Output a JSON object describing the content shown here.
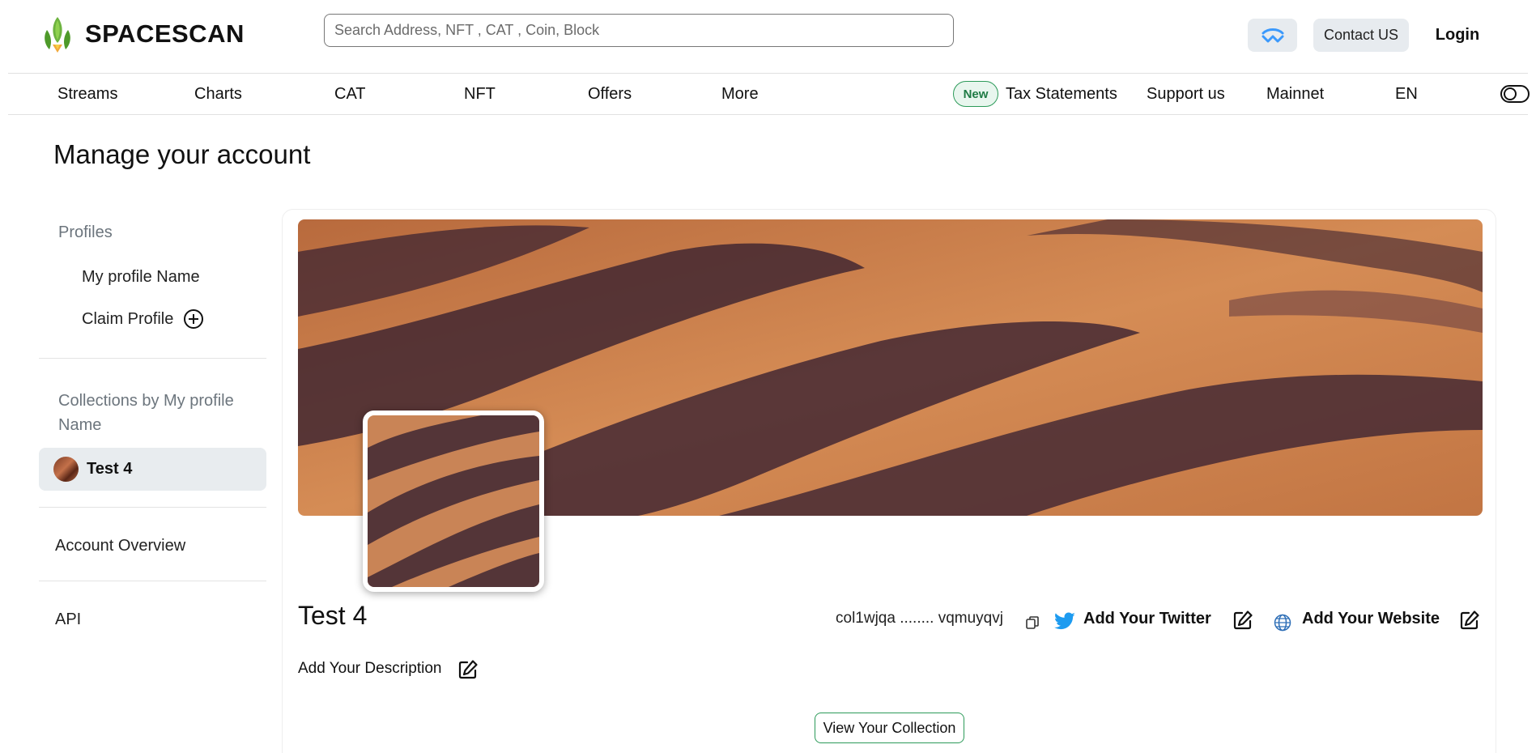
{
  "brand": {
    "name": "SPACESCAN"
  },
  "header": {
    "search_placeholder": "Search Address, NFT , CAT , Coin, Block",
    "contact_label": "Contact US",
    "login_label": "Login"
  },
  "nav": {
    "items": [
      "Streams",
      "Charts",
      "CAT",
      "NFT",
      "Offers",
      "More"
    ],
    "new_badge": "New",
    "tax_label": "Tax Statements",
    "support_label": "Support us",
    "network_label": "Mainnet",
    "language_label": "EN"
  },
  "page": {
    "title": "Manage your account"
  },
  "sidebar": {
    "profiles_heading": "Profiles",
    "profile_name": "My profile Name",
    "claim_label": "Claim Profile",
    "collections_heading": "Collections by My profile Name",
    "active_collection": "Test 4",
    "account_overview": "Account Overview",
    "api": "API"
  },
  "collection": {
    "name": "Test 4",
    "address": "col1wjqa ........ vqmuyqvj",
    "twitter_label": "Add Your Twitter",
    "website_label": "Add Your Website",
    "description_label": "Add Your Description",
    "view_button": "View Your Collection"
  },
  "colors": {
    "accent_green": "#2c9a59",
    "twitter_blue": "#1d9bf0",
    "button_gray": "#e7ebef",
    "wallet_blue": "#3b99fc"
  }
}
